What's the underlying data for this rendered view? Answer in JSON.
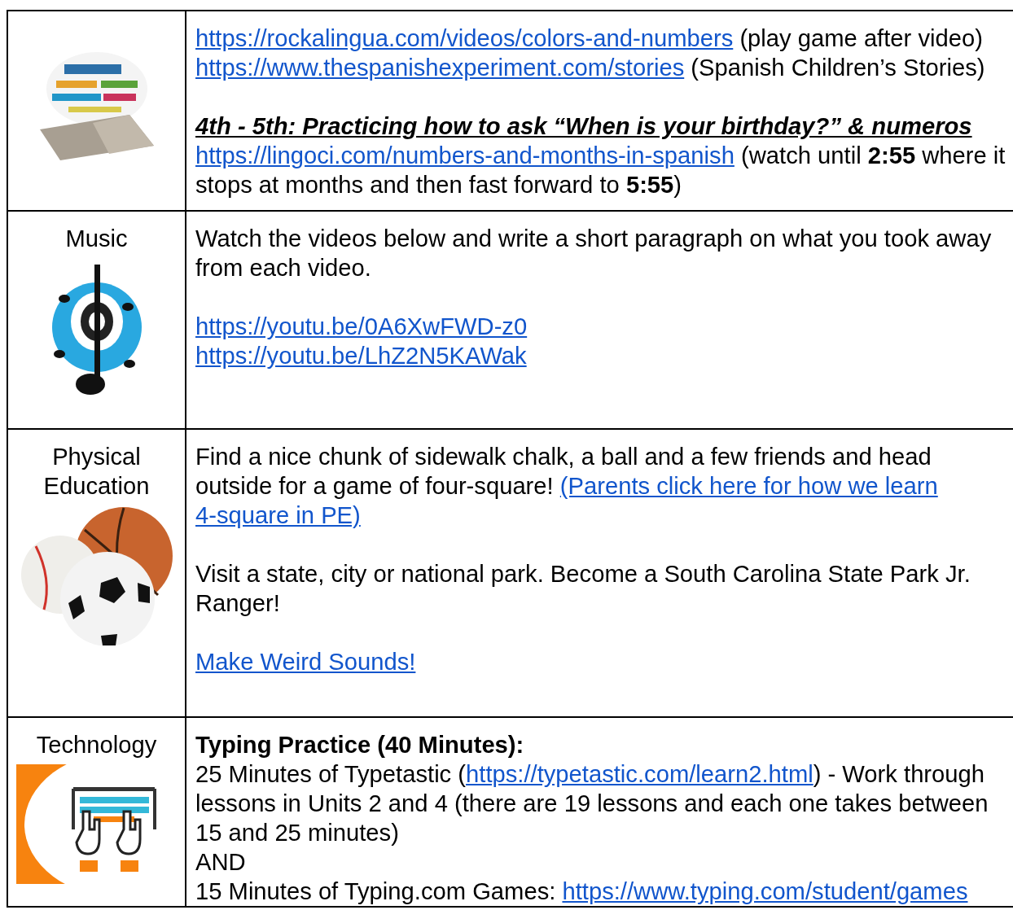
{
  "rows": [
    {
      "image": {
        "kind": "picture"
      },
      "groups": [
        [
          {
            "kind": "text",
            "runs": [
              {
                "kind": "link",
                "text": "https://rockalingua.com/videos/colors-and-numbers"
              },
              {
                "kind": "text",
                "text": " (play game after video)"
              }
            ]
          },
          {
            "kind": "text",
            "runs": [
              {
                "kind": "link",
                "text": "https://www.thespanishexperiment.com/stories"
              },
              {
                "kind": "text",
                "text": " (Spanish Children’s Stories)"
              }
            ]
          }
        ],
        [
          {
            "kind": "heading",
            "runs": [
              {
                "kind": "text",
                "text": "4th - 5th: Practicing how to ask “When is your birthday?” & numeros"
              }
            ]
          },
          {
            "kind": "text",
            "runs": [
              {
                "kind": "link",
                "text": "https://lingoci.com/numbers-and-months-in-spanish"
              },
              {
                "kind": "text",
                "text": " (watch until **2:55** where it stops at months and then fast forward to **5:55**)"
              }
            ]
          }
        ]
      ]
    },
    {
      "subject": "Music",
      "image": {
        "kind": "picture"
      },
      "groups": [
        [
          {
            "kind": "text",
            "runs": [
              {
                "kind": "text",
                "text": "Watch the videos below and write a short paragraph on what you took away from each video."
              }
            ]
          }
        ],
        [
          {
            "kind": "text",
            "runs": [
              {
                "kind": "link",
                "text": "https://youtu.be/0A6XwFWD-z0"
              }
            ]
          },
          {
            "kind": "text",
            "runs": [
              {
                "kind": "link",
                "text": "https://youtu.be/LhZ2N5KAWak"
              }
            ]
          }
        ]
      ]
    },
    {
      "subject": "Physical Education",
      "image": {
        "kind": "picture"
      },
      "groups": [
        [
          {
            "kind": "text",
            "runs": [
              {
                "kind": "text",
                "text": "Find a nice chunk of sidewalk chalk, a ball and a few friends and head outside for a game of four-square! "
              },
              {
                "kind": "link",
                "text": "(Parents click here for how we learn"
              },
              {
                "kind": "link",
                "text": "4-square in PE)"
              }
            ]
          }
        ],
        [
          {
            "kind": "text",
            "runs": [
              {
                "kind": "text",
                "text": "Visit a state, city or national park. Become a South Carolina State Park Jr. Ranger!"
              }
            ]
          }
        ],
        [
          {
            "kind": "text",
            "runs": [
              {
                "kind": "link",
                "text": "Make Weird Sounds!"
              }
            ]
          }
        ]
      ]
    },
    {
      "subject": "Technology",
      "image": {
        "kind": "picture"
      },
      "groups": [
        [
          {
            "kind": "strong",
            "runs": [
              {
                "kind": "text",
                "text": "Typing Practice (40 Minutes):"
              }
            ]
          },
          {
            "kind": "text",
            "runs": [
              {
                "kind": "text",
                "text": "25 Minutes of Typetastic ("
              },
              {
                "kind": "link",
                "text": "https://typetastic.com/learn2.html"
              },
              {
                "kind": "text",
                "text": ") - Work through lessons in Units 2 and 4 (there are 19 lessons and each one takes between 15 and 25 minutes)"
              }
            ]
          },
          {
            "kind": "text",
            "runs": [
              {
                "kind": "text",
                "text": "AND"
              }
            ]
          },
          {
            "kind": "text",
            "runs": [
              {
                "kind": "text",
                "text": "15 Minutes of Typing.com Games: "
              },
              {
                "kind": "link",
                "text": "https://www.typing.com/student/games"
              }
            ]
          }
        ]
      ]
    }
  ]
}
